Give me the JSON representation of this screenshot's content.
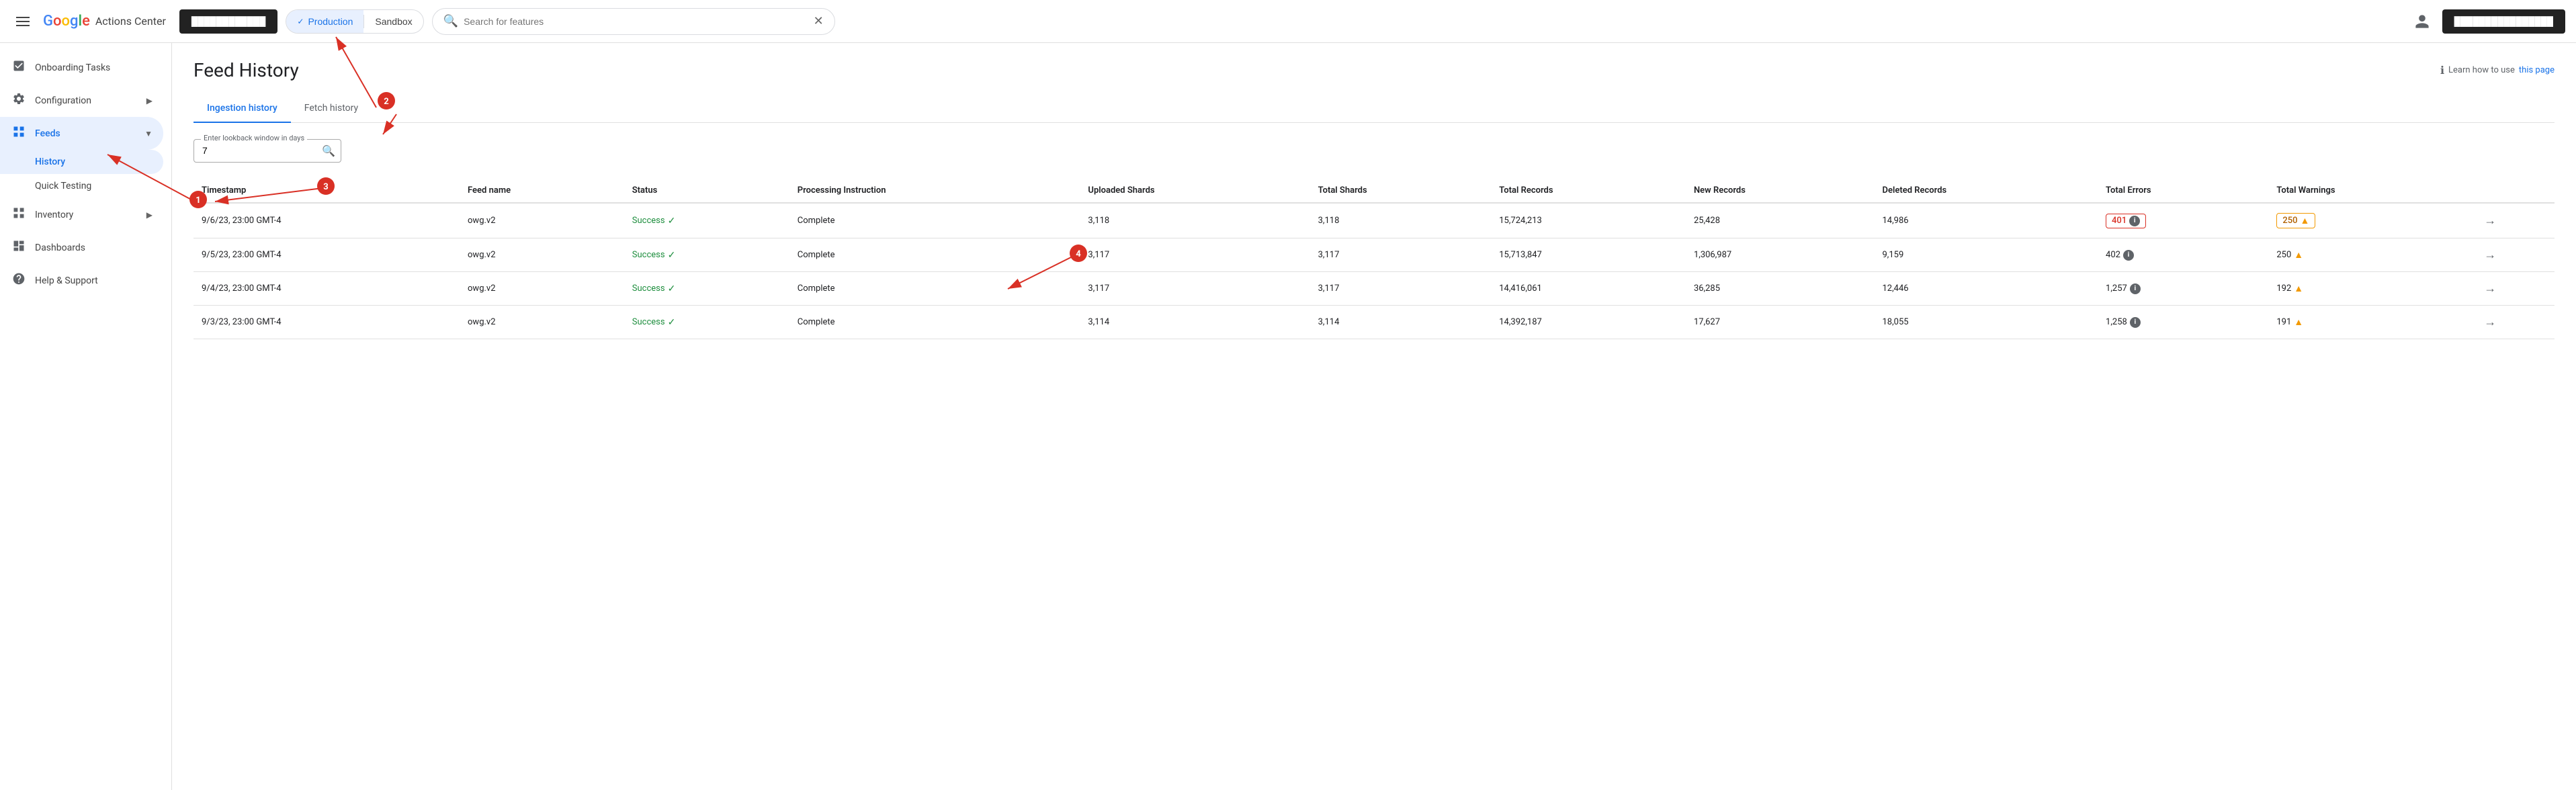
{
  "header": {
    "menu_label": "Menu",
    "logo": "Google",
    "app_name": "Actions Center",
    "account_pill": "████████████",
    "env_production": "Production",
    "env_sandbox": "Sandbox",
    "search_placeholder": "Search for features",
    "right_pill": "████████████████"
  },
  "sidebar": {
    "items": [
      {
        "id": "onboarding",
        "label": "Onboarding Tasks",
        "icon": "☑"
      },
      {
        "id": "configuration",
        "label": "Configuration",
        "icon": "⚙",
        "expandable": true
      },
      {
        "id": "feeds",
        "label": "Feeds",
        "icon": "▦",
        "expandable": true,
        "active": true
      },
      {
        "id": "history",
        "label": "History",
        "child": true,
        "active": true
      },
      {
        "id": "quick-testing",
        "label": "Quick Testing",
        "child": true
      },
      {
        "id": "inventory",
        "label": "Inventory",
        "icon": "▦",
        "expandable": true
      },
      {
        "id": "dashboards",
        "label": "Dashboards",
        "icon": "▦"
      },
      {
        "id": "help",
        "label": "Help & Support",
        "icon": "?"
      }
    ]
  },
  "main": {
    "page_title": "Feed History",
    "learn_text": "Learn how to use",
    "learn_link_text": "this page",
    "tabs": [
      {
        "id": "ingestion",
        "label": "Ingestion history",
        "active": true
      },
      {
        "id": "fetch",
        "label": "Fetch history",
        "active": false
      }
    ],
    "lookback_label": "Enter lookback window in days",
    "lookback_value": "7",
    "table": {
      "columns": [
        "Timestamp",
        "Feed name",
        "Status",
        "Processing Instruction",
        "Uploaded Shards",
        "Total Shards",
        "Total Records",
        "New Records",
        "Deleted Records",
        "Total Errors",
        "Total Warnings"
      ],
      "rows": [
        {
          "timestamp": "9/6/23, 23:00 GMT-4",
          "feed_name": "owg.v2",
          "status": "Success",
          "processing": "Complete",
          "uploaded_shards": "3,118",
          "total_shards": "3,118",
          "total_records": "15,724,213",
          "new_records": "25,428",
          "deleted_records": "14,986",
          "total_errors": "401",
          "total_warnings": "250",
          "highlighted": true
        },
        {
          "timestamp": "9/5/23, 23:00 GMT-4",
          "feed_name": "owg.v2",
          "status": "Success",
          "processing": "Complete",
          "uploaded_shards": "3,117",
          "total_shards": "3,117",
          "total_records": "15,713,847",
          "new_records": "1,306,987",
          "deleted_records": "9,159",
          "total_errors": "402",
          "total_warnings": "250",
          "highlighted": false
        },
        {
          "timestamp": "9/4/23, 23:00 GMT-4",
          "feed_name": "owg.v2",
          "status": "Success",
          "processing": "Complete",
          "uploaded_shards": "3,117",
          "total_shards": "3,117",
          "total_records": "14,416,061",
          "new_records": "36,285",
          "deleted_records": "12,446",
          "total_errors": "1,257",
          "total_warnings": "192",
          "highlighted": false
        },
        {
          "timestamp": "9/3/23, 23:00 GMT-4",
          "feed_name": "owg.v2",
          "status": "Success",
          "processing": "Complete",
          "uploaded_shards": "3,114",
          "total_shards": "3,114",
          "total_records": "14,392,187",
          "new_records": "17,627",
          "deleted_records": "18,055",
          "total_errors": "1,258",
          "total_warnings": "191",
          "highlighted": false
        }
      ]
    }
  },
  "annotations": {
    "num1": "1",
    "num2": "2",
    "num3": "3",
    "num4": "4"
  }
}
